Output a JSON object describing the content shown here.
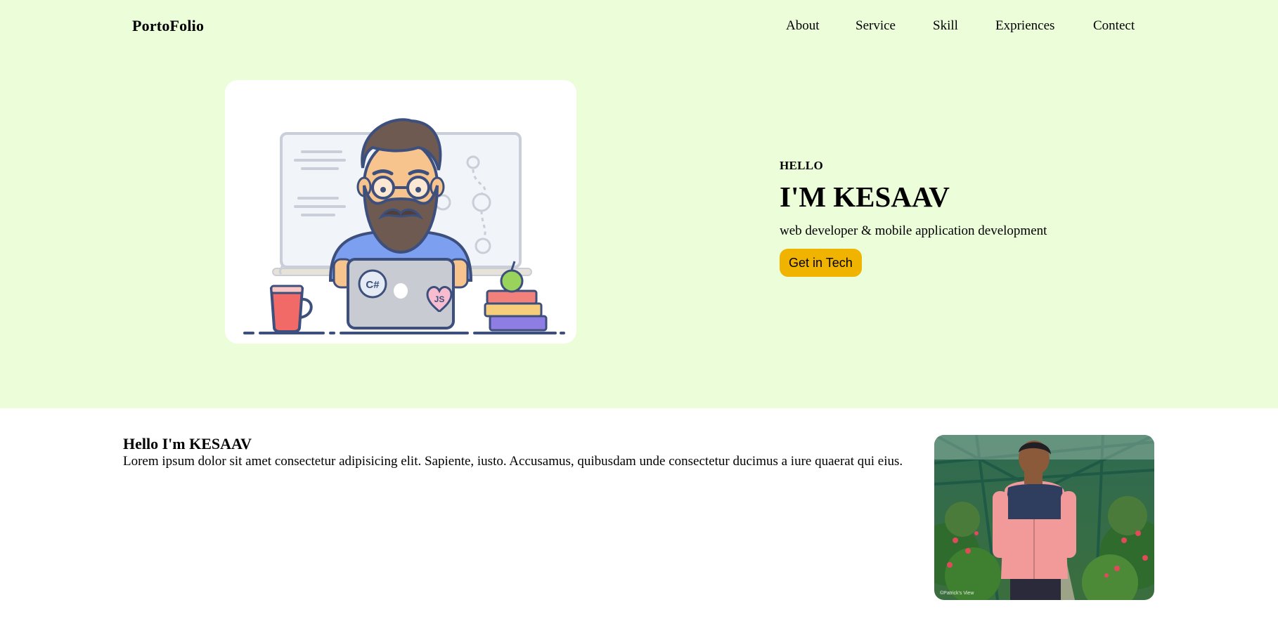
{
  "nav": {
    "brand": "PortoFolio",
    "links": [
      {
        "label": "About"
      },
      {
        "label": "Service"
      },
      {
        "label": "Skill"
      },
      {
        "label": "Expriences"
      },
      {
        "label": "Contect"
      }
    ]
  },
  "hero": {
    "eyebrow": "HELLO",
    "title": "I'M KESAAV",
    "subtitle": "web developer & mobile application development",
    "cta_label": "Get in Tech",
    "illustration_badges": {
      "left": "C#",
      "right": "JS"
    }
  },
  "about": {
    "heading": "Hello I'm KESAAV",
    "body": "Lorem ipsum dolor sit amet consectetur adipisicing elit. Sapiente, iusto. Accusamus, quibusdam unde consectetur ducimus a iure quaerat qui eius.",
    "photo_watermark": "©Patrick's View"
  },
  "colors": {
    "hero_bg": "#ebfdd9",
    "cta_bg": "#f0b400",
    "page_bg": "#ffffff"
  }
}
